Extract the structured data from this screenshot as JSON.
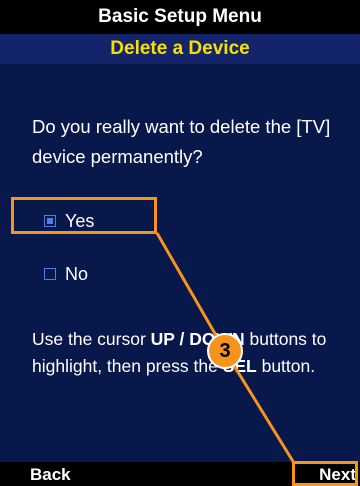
{
  "header": {
    "menu_title": "Basic Setup Menu",
    "subtitle": "Delete a Device"
  },
  "dialog": {
    "question": "Do you really want to delete the [TV] device permanently?",
    "options": [
      {
        "label": "Yes",
        "selected": true
      },
      {
        "label": "No",
        "selected": false
      }
    ],
    "instructions": {
      "part1": "Use the cursor ",
      "up_down": "UP / DOWN",
      "part2": " buttons to highlight, then press the ",
      "sel": "SEL",
      "part3": " button."
    }
  },
  "footer": {
    "back_label": "Back",
    "next_label": "Next"
  },
  "callout": {
    "step_number": "3"
  },
  "colors": {
    "screen_bg": "#08184b",
    "title_bar_bg": "#000000",
    "subtitle_bg": "#14246b",
    "subtitle_text": "#f7e000",
    "checkbox": "#4e7fe0",
    "callout": "#f7941d"
  }
}
